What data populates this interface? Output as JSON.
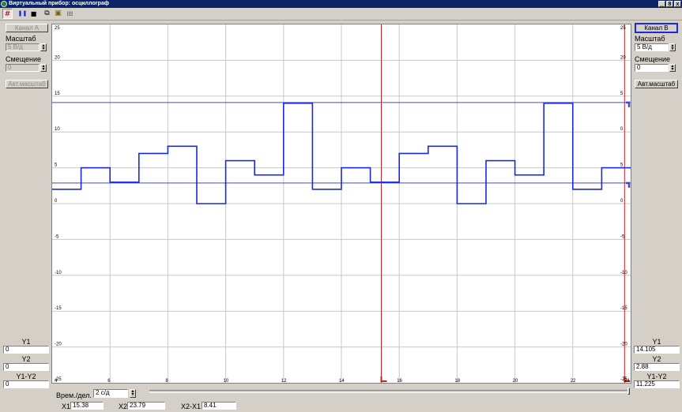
{
  "window": {
    "title": "Виртуальный прибор: осциллограф",
    "minimize": "_",
    "maximize": "8",
    "close": "x"
  },
  "toolbar": {
    "trigger": "#",
    "pause": "❚❚",
    "stop": "■",
    "copy": "⧉",
    "open": "▣",
    "grid": "⁞⁞⁞"
  },
  "channel_a": {
    "button": "Канал А",
    "scale_label": "Масштаб",
    "scale_value": "5 В/д",
    "offset_label": "Смещение",
    "offset_value": "0",
    "auto_scale": "Авт.масштаб"
  },
  "channel_b": {
    "button": "Канал В",
    "scale_label": "Масштаб",
    "scale_value": "5 В/д",
    "offset_label": "Смещение",
    "offset_value": "0",
    "auto_scale": "Авт.масштаб"
  },
  "left_readouts": {
    "y1_label": "Y1",
    "y1_value": "0",
    "y2_label": "Y2",
    "y2_value": "0",
    "dy_label": "Y1-Y2",
    "dy_value": "0"
  },
  "right_readouts": {
    "y1_label": "Y1",
    "y1_value": "14.105",
    "y2_label": "Y2",
    "y2_value": "2.88",
    "dy_label": "Y1-Y2",
    "dy_value": "11.225"
  },
  "bottom": {
    "time_label": "Врем./дел.",
    "time_value": "2 с/д",
    "x1_label": "X1",
    "x1_value": "15.38",
    "x2_label": "X2",
    "x2_value": "23.79",
    "dx_label": "X2-X1",
    "dx_value": "8.41"
  },
  "chart_data": {
    "type": "line",
    "grid": true,
    "xlim": [
      4,
      24
    ],
    "ylim": [
      -25,
      25
    ],
    "x_ticks": [
      "4",
      "6",
      "8",
      "10",
      "12",
      "14",
      "16",
      "18",
      "20",
      "22",
      "24"
    ],
    "y_ticks_left": [
      "25",
      "20",
      "15",
      "10",
      "5",
      "0",
      "-5",
      "-10",
      "-15",
      "-20",
      "-25"
    ],
    "y_ticks_right": [
      "25",
      "20",
      "5",
      "0",
      "5",
      "0",
      "-5",
      "-10",
      "-15",
      "-20",
      "-25"
    ],
    "series": [
      {
        "step": true,
        "color": "#1a2ad8",
        "x": [
          4,
          5,
          6,
          7,
          8,
          9,
          10,
          11,
          12,
          13,
          14,
          15,
          16,
          17,
          18,
          19,
          20,
          21,
          22,
          23,
          24
        ],
        "values": [
          2,
          5,
          3,
          7,
          8,
          0,
          6,
          4,
          14,
          2,
          5,
          3,
          7,
          8,
          0,
          6,
          4,
          14,
          2,
          5,
          5
        ]
      }
    ],
    "cursors": {
      "x1": 15.38,
      "x2": 23.79,
      "y1": 14.105,
      "y2": 2.88,
      "x_color": "#cc2020",
      "y_color": "#3a4ad8"
    }
  }
}
